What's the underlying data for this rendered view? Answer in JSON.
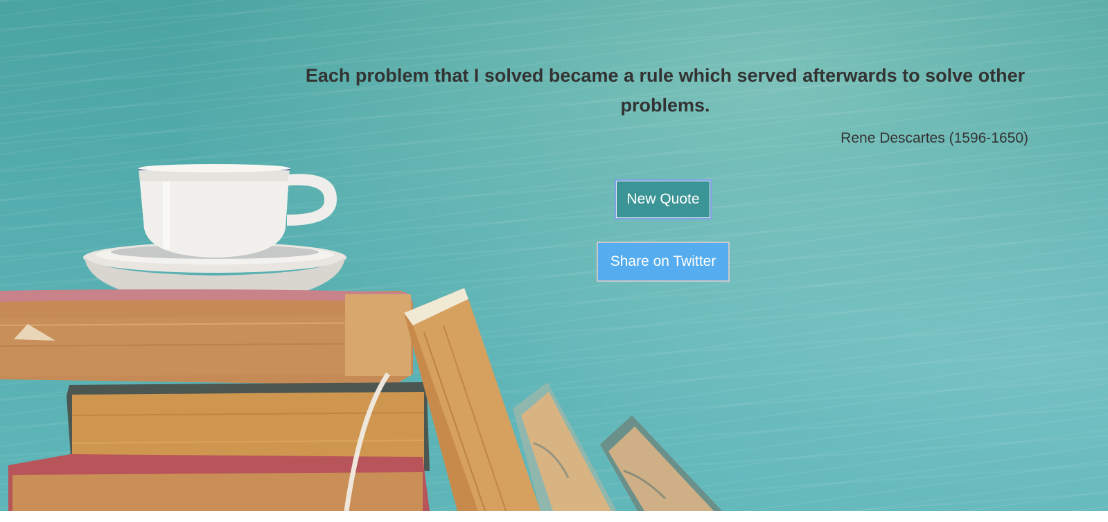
{
  "quote": {
    "text": "Each problem that I solved became a rule which served afterwards to solve other problems.",
    "author": "Rene Descartes (1596-1650)"
  },
  "actions": {
    "new_quote_label": "New Quote",
    "share_label": "Share on Twitter"
  },
  "colors": {
    "text": "#333333",
    "new_quote_button": "#3b9495",
    "twitter_button": "#55acee",
    "background": "#56aeb0"
  }
}
